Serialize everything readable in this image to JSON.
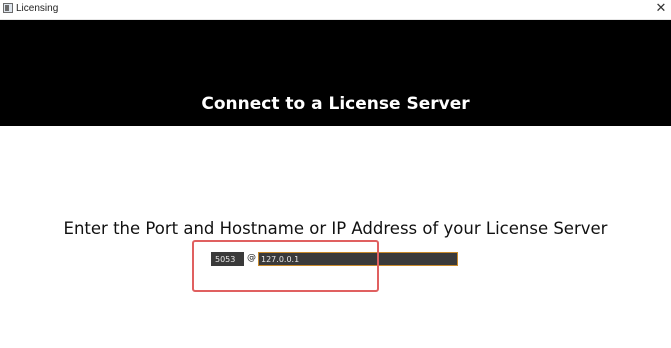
{
  "window": {
    "title": "Licensing",
    "close_glyph": "✕",
    "icon": "window-app-icon"
  },
  "banner": {
    "title": "Connect to a License Server"
  },
  "form": {
    "prompt": "Enter the Port and Hostname or IP Address of your License Server",
    "port_value": "5053",
    "separator": "@",
    "host_value": "127.0.0.1"
  },
  "colors": {
    "banner_bg": "#000000",
    "input_bg": "#3a3a3a",
    "host_focus_border": "#c98a2b",
    "annotation_box": "#e06060"
  }
}
